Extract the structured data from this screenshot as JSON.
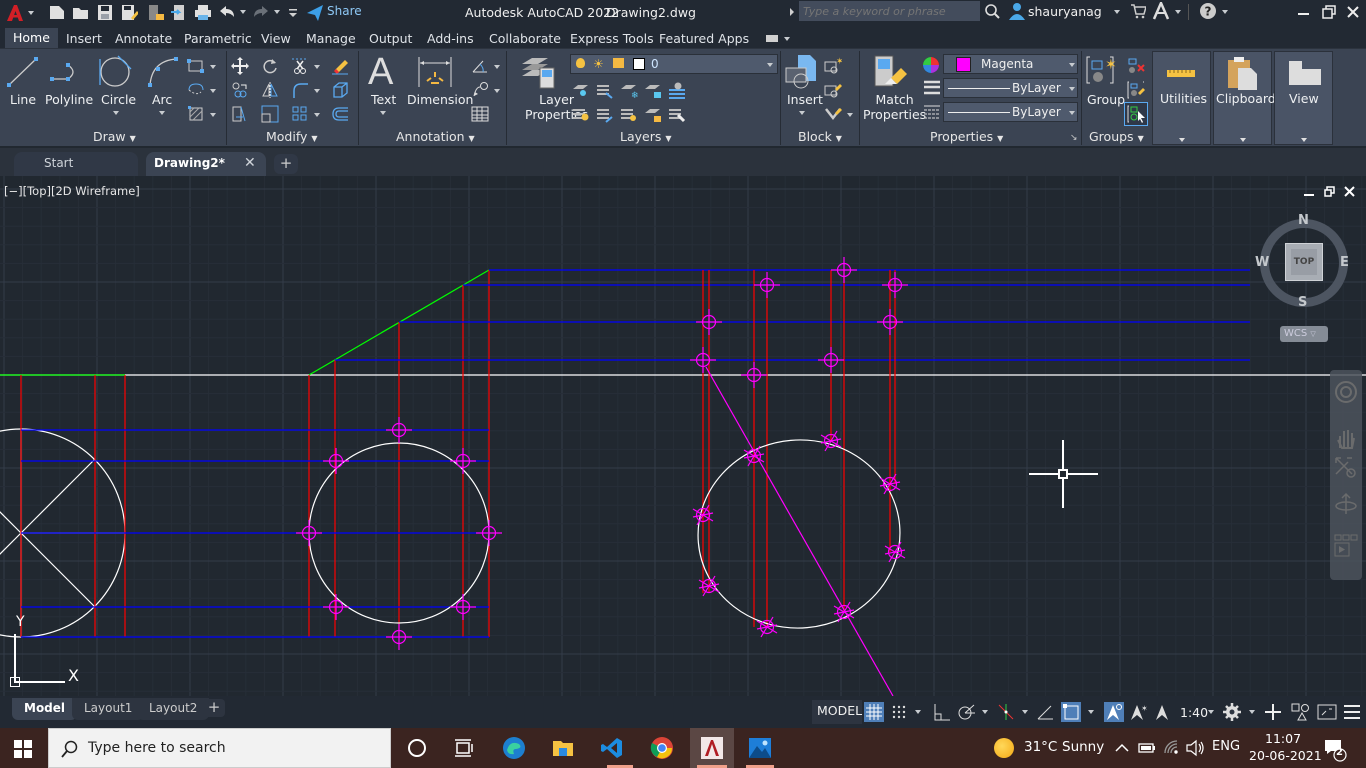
{
  "titlebar": {
    "app_title": "Autodesk AutoCAD 2022",
    "file_name": "Drawing2.dwg",
    "share_label": "Share",
    "search_placeholder": "Type a keyword or phrase",
    "username": "shauryanag"
  },
  "ribbon_tabs": [
    "Home",
    "Insert",
    "Annotate",
    "Parametric",
    "View",
    "Manage",
    "Output",
    "Add-ins",
    "Collaborate",
    "Express Tools",
    "Featured Apps"
  ],
  "active_ribbon_tab": "Home",
  "panels": {
    "draw": {
      "label": "Draw",
      "buttons": [
        "Line",
        "Polyline",
        "Circle",
        "Arc"
      ]
    },
    "modify": {
      "label": "Modify"
    },
    "annotation": {
      "label": "Annotation",
      "buttons": [
        "Text",
        "Dimension"
      ]
    },
    "layers": {
      "label": "Layers",
      "layer_properties": "Layer Properties",
      "layer_properties_l1": "Layer",
      "layer_properties_l2": "Properties",
      "current_layer": "0"
    },
    "block": {
      "label": "Block",
      "insert": "Insert"
    },
    "properties": {
      "label": "Properties",
      "match_l1": "Match",
      "match_l2": "Properties",
      "color": "Magenta",
      "color_hex": "#ff00ff",
      "lineweight": "ByLayer",
      "linetype": "ByLayer"
    },
    "groups": {
      "label": "Groups",
      "group": "Group"
    },
    "utilities": {
      "label": "Utilities"
    },
    "clipboard": {
      "label": "Clipboard"
    },
    "view": {
      "label": "View"
    }
  },
  "doc_tabs": [
    {
      "label": "Start",
      "active": false
    },
    {
      "label": "Drawing2*",
      "active": true
    }
  ],
  "viewport": {
    "label": "[−][Top][2D Wireframe]",
    "viewcube": {
      "face": "TOP",
      "north": "N",
      "south": "S",
      "east": "E",
      "west": "W",
      "ucs": "WCS"
    },
    "ucs_x": "X",
    "ucs_y": "Y"
  },
  "layout_tabs": [
    {
      "label": "Model",
      "active": true
    },
    {
      "label": "Layout1",
      "active": false
    },
    {
      "label": "Layout2",
      "active": false
    }
  ],
  "statusbar": {
    "model": "MODEL",
    "scale": "1:40"
  },
  "taskbar": {
    "search_placeholder": "Type here to search",
    "weather_temp": "31°C",
    "weather_desc": "Sunny",
    "language": "ENG",
    "time": "11:07",
    "date": "20-06-2021",
    "notifications": "2"
  },
  "colors": {
    "accent": "#4f93d8",
    "grid_bg": "#212830",
    "construction_red": "#ff0000",
    "projection_blue": "#0000ff",
    "point_magenta": "#ff00ff",
    "inclined_green": "#00ff00"
  }
}
